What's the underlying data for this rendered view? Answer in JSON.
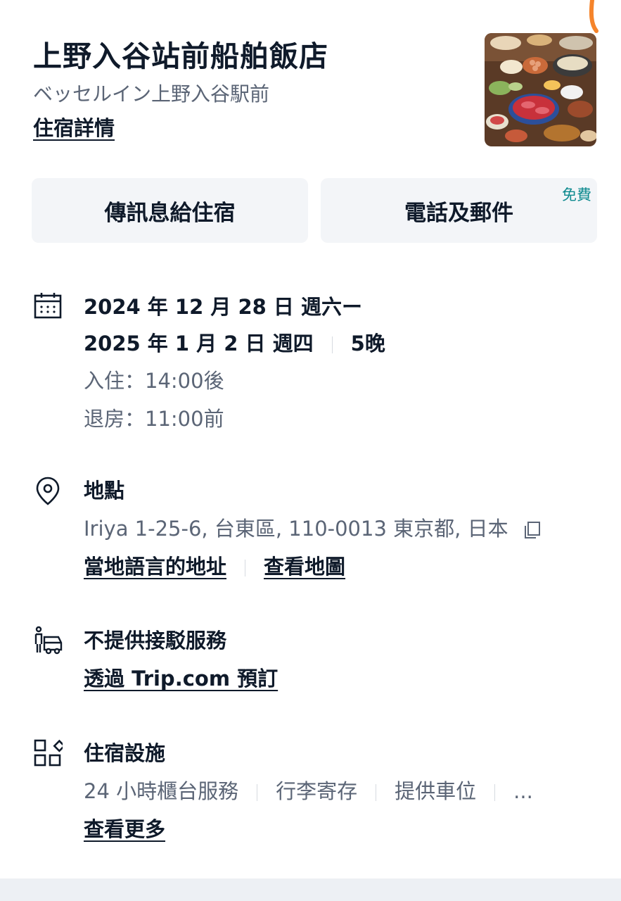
{
  "hotel": {
    "name": "上野入谷站前船舶飯店",
    "subtitle": "ベッセルイン上野入谷駅前",
    "details_link": "住宿詳情"
  },
  "actions": {
    "message_label": "傳訊息給住宿",
    "call_label": "電話及郵件",
    "free_badge": "免費"
  },
  "stay": {
    "date_line_1": "2024 年 12 月 28 日 週六ー",
    "date_line_2": "2025 年 1 月 2 日 週四",
    "nights": "5晚",
    "check_in": "入住：14:00後",
    "check_out": "退房：11:00前"
  },
  "location": {
    "title": "地點",
    "address": "Iriya 1-25-6, 台東區, 110-0013 東京都, 日本",
    "local_address_link": "當地語言的地址",
    "map_link": "查看地圖"
  },
  "shuttle": {
    "title": "不提供接駁服務",
    "book_link": "透過 Trip.com 預訂"
  },
  "facilities": {
    "title": "住宿設施",
    "items": [
      "24 小時櫃台服務",
      "行李寄存",
      "提供車位",
      "..."
    ],
    "more_link": "查看更多"
  },
  "colors": {
    "text_dark": "#0f1a2a",
    "text_gray": "#5b6576",
    "button_bg": "#f3f5f8",
    "free_badge": "#0e8a8f",
    "corner_mark": "#f5842b"
  }
}
